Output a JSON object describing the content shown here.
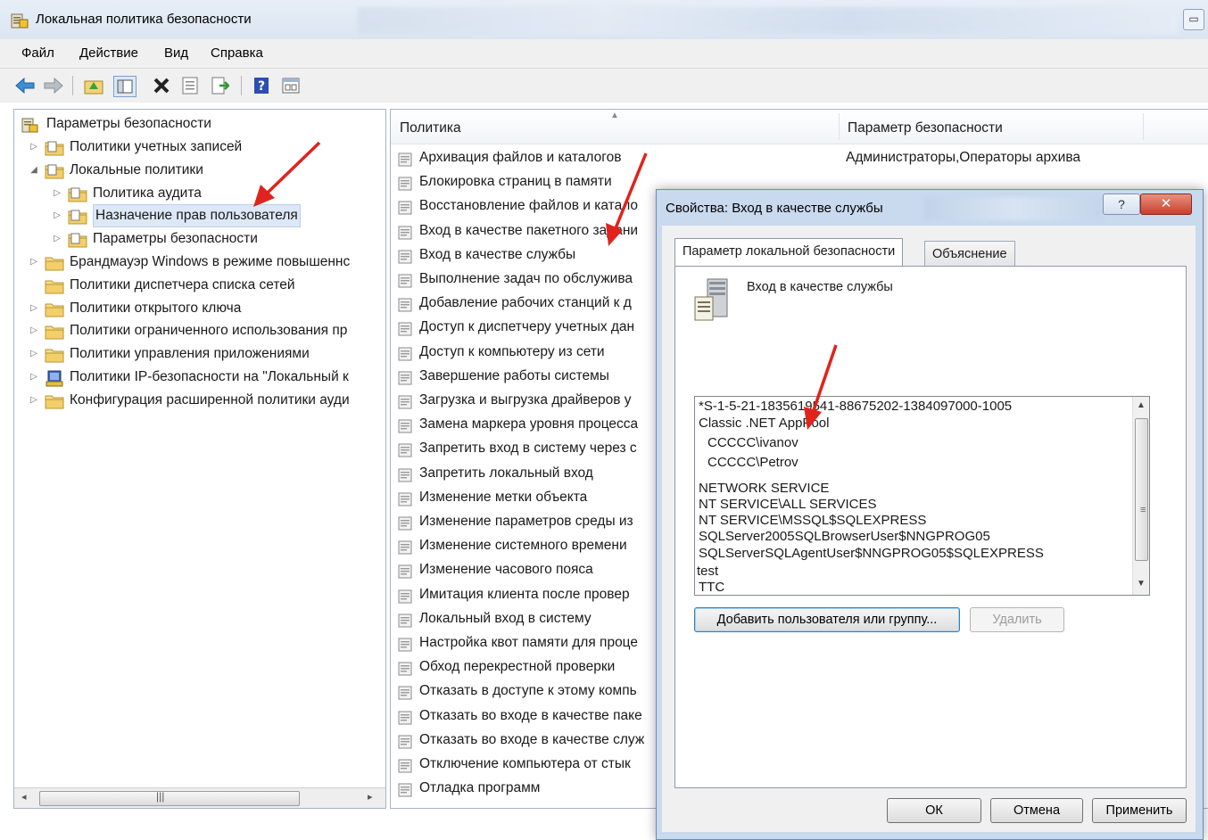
{
  "window": {
    "title": "Локальная политика безопасности"
  },
  "menu": [
    "Файл",
    "Действие",
    "Вид",
    "Справка"
  ],
  "toolbar_icons": [
    "back-arrow-icon",
    "forward-arrow-icon",
    "up-folder-icon",
    "show-hide-tree-icon",
    "delete-icon",
    "properties-icon",
    "export-list-icon",
    "help-icon",
    "console-view-icon"
  ],
  "tree": {
    "root": "Параметры безопасности",
    "items": [
      {
        "label": "Политики учетных записей",
        "level": 1,
        "expander": "▷"
      },
      {
        "label": "Локальные политики",
        "level": 1,
        "expander": "◢"
      },
      {
        "label": "Политика аудита",
        "level": 2,
        "expander": "▷"
      },
      {
        "label": "Назначение прав пользователя",
        "level": 2,
        "expander": "▷",
        "selected": true
      },
      {
        "label": "Параметры безопасности",
        "level": 2,
        "expander": "▷"
      },
      {
        "label": "Брандмауэр Windows в режиме повышеннс",
        "level": 1,
        "expander": "▷"
      },
      {
        "label": "Политики диспетчера списка сетей",
        "level": 1,
        "expander": ""
      },
      {
        "label": "Политики открытого ключа",
        "level": 1,
        "expander": "▷"
      },
      {
        "label": "Политики ограниченного использования пр",
        "level": 1,
        "expander": "▷"
      },
      {
        "label": "Политики управления приложениями",
        "level": 1,
        "expander": "▷"
      },
      {
        "label": "Политики IP-безопасности на \"Локальный к",
        "level": 1,
        "expander": "▷"
      },
      {
        "label": "Конфигурация расширенной политики ауди",
        "level": 1,
        "expander": "▷"
      }
    ],
    "scroll_grip": "|||"
  },
  "list": {
    "columns": [
      "Политика",
      "Параметр безопасности"
    ],
    "rows": [
      {
        "policy": "Архивация файлов и каталогов",
        "value": "Администраторы,Операторы архива"
      },
      {
        "policy": "Блокировка страниц в памяти",
        "value": ""
      },
      {
        "policy": "Восстановление файлов и катало",
        "value": ""
      },
      {
        "policy": "Вход в качестве пакетного задани",
        "value": ""
      },
      {
        "policy": "Вход в качестве службы",
        "value": ""
      },
      {
        "policy": "Выполнение задач по обслужива",
        "value": ""
      },
      {
        "policy": "Добавление рабочих станций к д",
        "value": ""
      },
      {
        "policy": "Доступ к диспетчеру учетных дан",
        "value": ""
      },
      {
        "policy": "Доступ к компьютеру из сети",
        "value": ""
      },
      {
        "policy": "Завершение работы системы",
        "value": ""
      },
      {
        "policy": "Загрузка и выгрузка драйверов у",
        "value": ""
      },
      {
        "policy": "Замена маркера уровня процесса",
        "value": ""
      },
      {
        "policy": "Запретить вход в систему через с",
        "value": ""
      },
      {
        "policy": "Запретить локальный вход",
        "value": ""
      },
      {
        "policy": "Изменение метки объекта",
        "value": ""
      },
      {
        "policy": "Изменение параметров среды из",
        "value": ""
      },
      {
        "policy": "Изменение системного времени",
        "value": ""
      },
      {
        "policy": "Изменение часового пояса",
        "value": ""
      },
      {
        "policy": "Имитация клиента после провер",
        "value": ""
      },
      {
        "policy": "Локальный вход в систему",
        "value": ""
      },
      {
        "policy": "Настройка квот памяти для проце",
        "value": ""
      },
      {
        "policy": "Обход перекрестной проверки",
        "value": ""
      },
      {
        "policy": "Отказать в доступе к этому компь",
        "value": ""
      },
      {
        "policy": "Отказать во входе в качестве паке",
        "value": ""
      },
      {
        "policy": "Отказать во входе в качестве служ",
        "value": ""
      },
      {
        "policy": "Отключение компьютера от стык",
        "value": ""
      },
      {
        "policy": "Отладка программ",
        "value": ""
      }
    ]
  },
  "dialog": {
    "title": "Свойства: Вход в качестве службы",
    "help_label": "?",
    "close_label": "✕",
    "tabs": [
      "Параметр локальной безопасности",
      "Объяснение"
    ],
    "policy_name": "Вход в качестве службы",
    "accounts": [
      "*S-1-5-21-1835619541-88675202-1384097000-1005",
      "Classic .NET AppPool",
      "CCCCC\\ivanov",
      "CCCCC\\Petrov",
      "NETWORK SERVICE",
      "NT SERVICE\\ALL SERVICES",
      "NT SERVICE\\MSSQL$SQLEXPRESS",
      "SQLServer2005SQLBrowserUser$NNGPROG05",
      "SQLServerSQLAgentUser$NNGPROG05$SQLEXPRESS",
      "test",
      "TTC"
    ],
    "add_button": "Добавить пользователя или группу...",
    "remove_button": "Удалить",
    "ok_button": "ОК",
    "cancel_button": "Отмена",
    "apply_button": "Применить"
  },
  "colors": {
    "selection": "#dde8f7",
    "annotation_arrow": "#e0231c",
    "dialog_frame": "#c9d9ee"
  }
}
